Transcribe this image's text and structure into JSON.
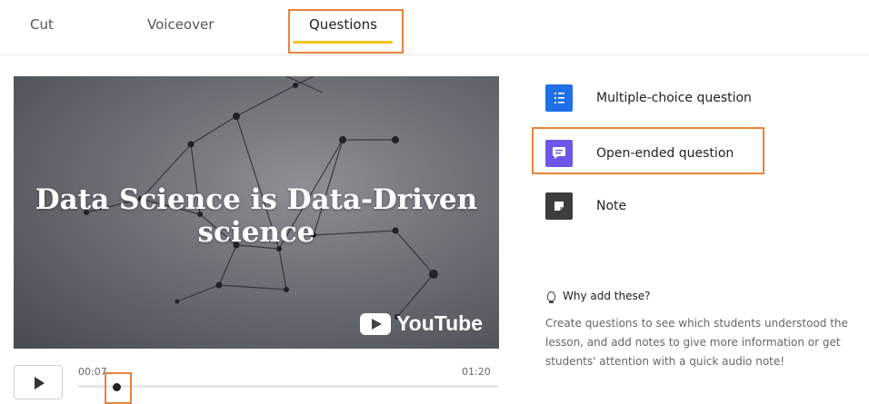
{
  "tabs": [
    {
      "label": "Cut"
    },
    {
      "label": "Voiceover"
    },
    {
      "label": "Questions",
      "active": true
    }
  ],
  "video": {
    "title": "Data Science is Data-Driven science",
    "brand": "YouTube"
  },
  "player": {
    "current_time": "00:07",
    "end_time": "01:20"
  },
  "question_types": [
    {
      "label": "Multiple-choice question",
      "icon": "list-icon",
      "color": "#1e6fe8"
    },
    {
      "label": "Open-ended question",
      "icon": "comment-icon",
      "color": "#6b58e6"
    },
    {
      "label": "Note",
      "icon": "note-icon",
      "color": "#3d3d3d"
    }
  ],
  "why": {
    "heading": "Why add these?",
    "text": "Create questions to see which students understood the lesson, and add notes to give more information or get students' attention with a quick audio note!"
  },
  "colors": {
    "accent_underline": "#f5c518",
    "highlight": "#e8833a"
  }
}
